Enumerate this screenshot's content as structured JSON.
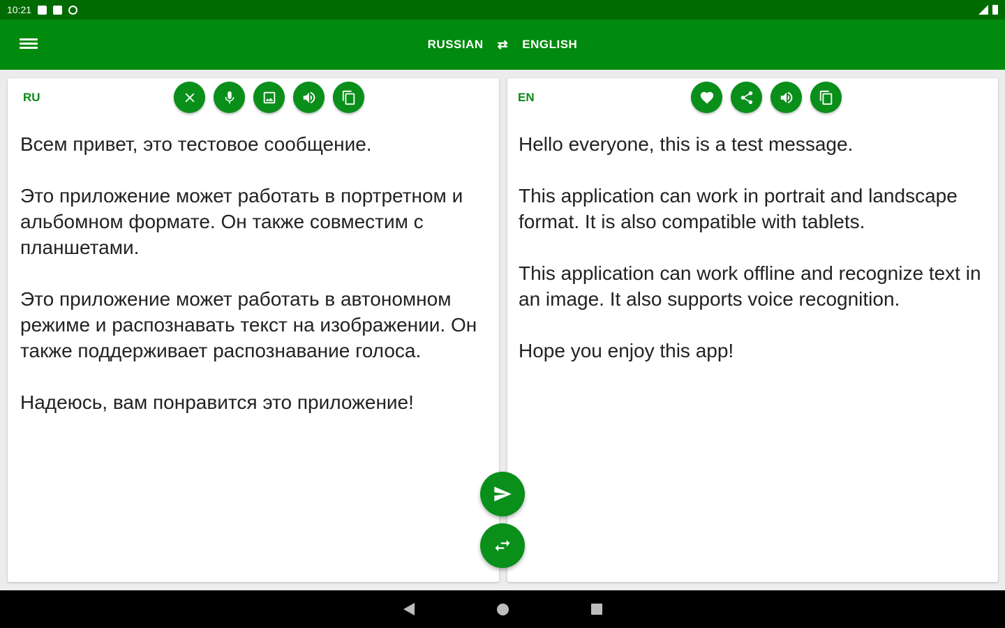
{
  "status_bar": {
    "time": "10:21",
    "icons": [
      "notification-icon",
      "sd-card-icon",
      "sync-off-icon"
    ],
    "right_icons": [
      "signal-icon",
      "battery-icon"
    ]
  },
  "app_bar": {
    "source_language": "RUSSIAN",
    "target_language": "ENGLISH",
    "swap_icon": "⇄"
  },
  "colors": {
    "status_bar": "#006b00",
    "app_bar": "#008a0e",
    "accent": "#0a8f1a",
    "background": "#ececec"
  },
  "source_panel": {
    "lang_code": "RU",
    "buttons": [
      "clear-button",
      "microphone-button",
      "image-button",
      "speaker-button",
      "copy-button"
    ],
    "paragraphs": [
      "Всем привет, это тестовое сообщение.",
      "Это приложение может работать в портретном и альбомном формате. Он также совместим с планшетами.",
      "Это приложение может работать в автономном режиме и распознавать текст на изображении. Он также поддерживает распознавание голоса.",
      "Надеюсь, вам понравится это приложение!"
    ]
  },
  "target_panel": {
    "lang_code": "EN",
    "buttons": [
      "favorite-button",
      "share-button",
      "speaker-button",
      "copy-button"
    ],
    "paragraphs": [
      "Hello everyone, this is a test message.",
      "This application can work in portrait and landscape format. It is also compatible with tablets.",
      "This application can work offline and recognize text in an image. It also supports voice recognition.",
      "Hope you enjoy this app!"
    ]
  },
  "fabs": [
    "translate-fab",
    "swap-languages-fab"
  ],
  "nav_bar": [
    "back",
    "home",
    "recents"
  ]
}
